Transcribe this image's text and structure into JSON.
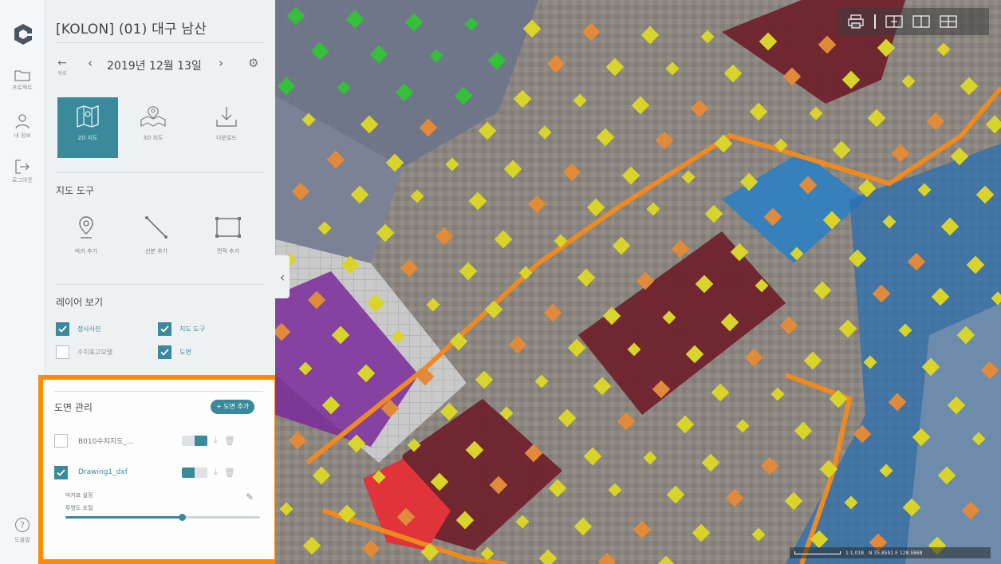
{
  "project": {
    "title": "[KOLON] (01) 대구 남산"
  },
  "rail": [
    {
      "label": "프로젝트",
      "icon": "folder-icon"
    },
    {
      "label": "내 정보",
      "icon": "person-icon"
    },
    {
      "label": "로그아웃",
      "icon": "logout-icon"
    }
  ],
  "nav": {
    "back_label": "뒤로",
    "date": "2019년 12월 13일"
  },
  "modes": [
    {
      "label": "2D 지도",
      "icon": "map-2d-icon",
      "active": true
    },
    {
      "label": "3D 지도",
      "icon": "map-3d-icon",
      "active": false
    },
    {
      "label": "다운로드",
      "icon": "download-icon",
      "active": false
    }
  ],
  "map_tools": {
    "title": "지도 도구",
    "items": [
      {
        "label": "마커 추가",
        "icon": "marker-icon"
      },
      {
        "label": "선분 추가",
        "icon": "line-icon"
      },
      {
        "label": "면적 추가",
        "icon": "area-icon"
      }
    ]
  },
  "layers": {
    "title": "레이어 보기",
    "items": [
      {
        "label": "정사사진",
        "checked": true
      },
      {
        "label": "지도 도구",
        "checked": true
      },
      {
        "label": "수치표고모델",
        "checked": false
      },
      {
        "label": "도면",
        "checked": true
      }
    ]
  },
  "drawing_management": {
    "title": "도면 관리",
    "add_label": "+ 도면 추가",
    "drawings": [
      {
        "name": "B010수치지도_...",
        "checked": false
      },
      {
        "name": "Drawing1_dxf",
        "checked": true
      }
    ],
    "marker_settings_label": "마커표 설정",
    "opacity_label": "투명도 조절",
    "opacity_value": 0.6
  },
  "help_label": "도움말",
  "map": {
    "scale_text": "1:1,018",
    "coord_text": "N 35.8591 E 128.5868",
    "toolbar": [
      "print-icon",
      "compare-icon",
      "split-2-icon",
      "split-4-icon"
    ]
  },
  "colors": {
    "accent": "#3a8a9c",
    "highlight": "#ff8c00"
  }
}
